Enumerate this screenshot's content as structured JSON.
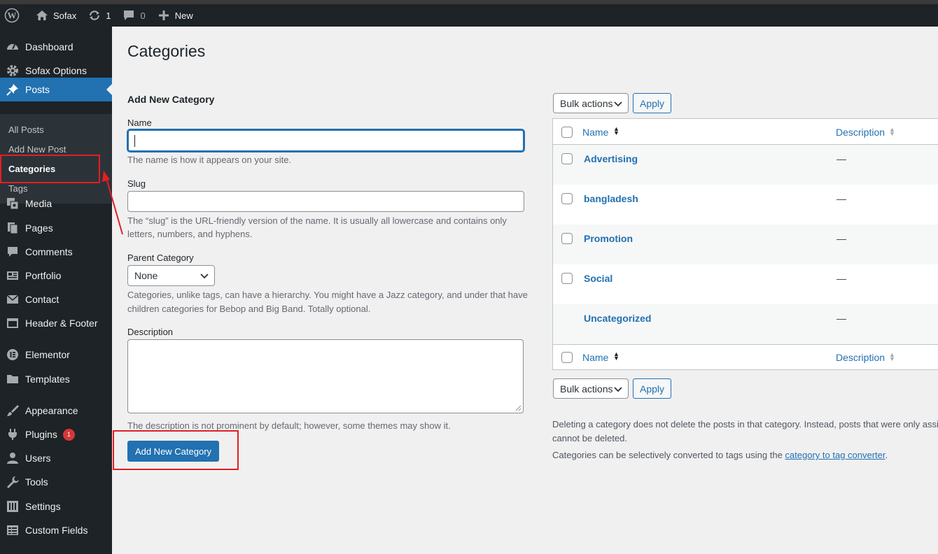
{
  "admin_bar": {
    "site_name": "Sofax",
    "updates_count": "1",
    "comments_count": "0",
    "new_label": "New"
  },
  "sidebar": {
    "items": [
      {
        "label": "Dashboard",
        "icon": "dashboard-icon"
      },
      {
        "label": "Sofax Options",
        "icon": "gear-icon"
      },
      {
        "label": "Posts",
        "icon": "pin-icon"
      },
      {
        "label": "Media",
        "icon": "media-icon"
      },
      {
        "label": "Pages",
        "icon": "pages-icon"
      },
      {
        "label": "Comments",
        "icon": "comment-icon"
      },
      {
        "label": "Portfolio",
        "icon": "portfolio-icon"
      },
      {
        "label": "Contact",
        "icon": "mail-icon"
      },
      {
        "label": "Header & Footer",
        "icon": "layout-icon"
      },
      {
        "label": "Elementor",
        "icon": "elementor-icon"
      },
      {
        "label": "Templates",
        "icon": "folder-icon"
      },
      {
        "label": "Appearance",
        "icon": "brush-icon"
      },
      {
        "label": "Plugins",
        "icon": "plug-icon",
        "badge": "1"
      },
      {
        "label": "Users",
        "icon": "user-icon"
      },
      {
        "label": "Tools",
        "icon": "wrench-icon"
      },
      {
        "label": "Settings",
        "icon": "sliders-icon"
      },
      {
        "label": "Custom Fields",
        "icon": "table-icon"
      }
    ],
    "submenu": [
      "All Posts",
      "Add New Post",
      "Categories",
      "Tags"
    ]
  },
  "page": {
    "title": "Categories"
  },
  "form": {
    "heading": "Add New Category",
    "name_label": "Name",
    "name_value": "",
    "name_help": "The name is how it appears on your site.",
    "slug_label": "Slug",
    "slug_value": "",
    "slug_help_1": "The “slug” is the URL-friendly version of the name. It is usually all lowercase and contains only",
    "slug_help_2": "letters, numbers, and hyphens.",
    "parent_label": "Parent Category",
    "parent_value": "None",
    "parent_help_1": "Categories, unlike tags, can have a hierarchy. You might have a Jazz category, and under that have",
    "parent_help_2": "children categories for Bebop and Big Band. Totally optional.",
    "description_label": "Description",
    "description_value": "",
    "description_help": "The description is not prominent by default; however, some themes may show it.",
    "submit_label": "Add New Category"
  },
  "table": {
    "bulk_actions": "Bulk actions",
    "apply": "Apply",
    "columns": {
      "name": "Name",
      "description": "Description"
    },
    "rows": [
      {
        "name": "Advertising",
        "description": "—"
      },
      {
        "name": "bangladesh",
        "description": "—"
      },
      {
        "name": "Promotion",
        "description": "—"
      },
      {
        "name": "Social",
        "description": "—"
      },
      {
        "name": "Uncategorized",
        "description": "—"
      }
    ]
  },
  "notes": {
    "line1a": "Deleting a category does not delete the posts in that category. Instead, posts that were only assi",
    "line1b": "cannot be deleted.",
    "line2_prefix": "Categories can be selectively converted to tags using the ",
    "line2_link": "category to tag converter",
    "line2_suffix": "."
  },
  "colors": {
    "admin_dark": "#1d2327",
    "accent": "#2271b1",
    "annotation_red": "#e31e24"
  }
}
